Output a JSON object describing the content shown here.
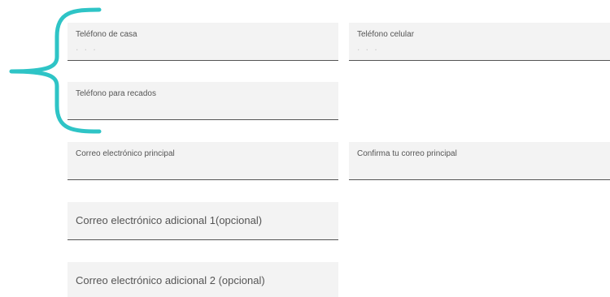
{
  "form": {
    "phone_home": {
      "label": "Teléfono de casa",
      "placeholder": ". . ."
    },
    "phone_mobile": {
      "label": "Teléfono celular",
      "placeholder": ". . ."
    },
    "phone_messages": {
      "label": "Teléfono para recados"
    },
    "email_primary": {
      "label": "Correo electrónico principal"
    },
    "email_confirm": {
      "label": "Confirma tu correo principal"
    },
    "email_additional_1": {
      "label": "Correo electrónico adicional 1(opcional)"
    },
    "email_additional_2": {
      "label": "Correo electrónico adicional 2 (opcional)"
    }
  },
  "annotation": {
    "bracket_color": "#2ec4c6"
  }
}
